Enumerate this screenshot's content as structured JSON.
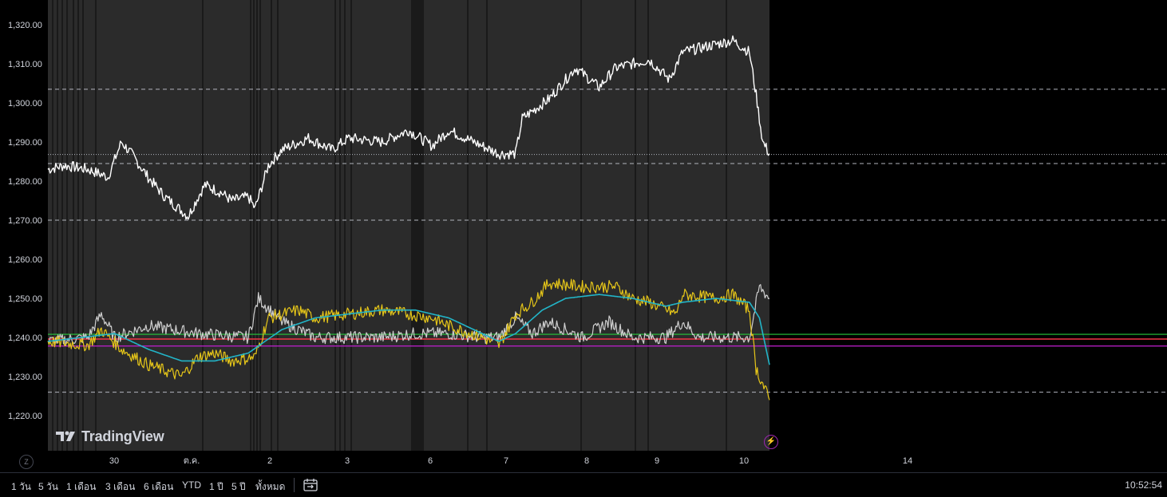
{
  "y_axis": {
    "ticks": [
      "1,320.00",
      "1,310.00",
      "1,300.00",
      "1,290.00",
      "1,280.00",
      "1,270.00",
      "1,260.00",
      "1,250.00",
      "1,240.00",
      "1,230.00",
      "1,220.00"
    ],
    "tick_values": [
      1320,
      1310,
      1300,
      1290,
      1280,
      1270,
      1260,
      1250,
      1240,
      1230,
      1220
    ]
  },
  "x_axis": {
    "ticks": [
      "30",
      "ต.ค.",
      "2",
      "3",
      "6",
      "7",
      "8",
      "9",
      "10",
      "14"
    ]
  },
  "scale_mode_label": "Z",
  "logo": {
    "text": "TradingView",
    "icon": "tradingview-logo-icon"
  },
  "alert_icon": "lightning-icon",
  "bottom_toolbar": {
    "ranges": [
      "1 วัน",
      "5 วัน",
      "1 เดือน",
      "3 เดือน",
      "6 เดือน",
      "YTD",
      "1 ปี",
      "5 ปี",
      "ทั้งหมด"
    ],
    "goto_icon": "calendar-goto-icon",
    "clock": "10:52:54"
  },
  "colors": {
    "price_line": "#ffffff",
    "white_osc": "#cfcfcf",
    "yellow_osc": "#e6c619",
    "cyan_ma": "#22b5c8",
    "green_level": "#26c93b",
    "red_level": "#f23645",
    "magenta_level": "#c21fd0",
    "dashed_level": "#b2b5be",
    "session_bg": "#2b2b2b"
  },
  "chart_data": {
    "type": "line",
    "title": "",
    "xlabel": "",
    "ylabel": "",
    "ylim": [
      1215,
      1324
    ],
    "horizontal_levels": {
      "dashed": [
        1303.5,
        1284.5,
        1270,
        1226
      ],
      "dotted": [
        1286.8
      ],
      "green": 1240.8,
      "red": 1239.6,
      "magenta": 1237.8
    },
    "series": [
      {
        "values": [
          [
            0,
            1283
          ],
          [
            5,
            1284
          ],
          [
            12,
            1283
          ],
          [
            18,
            1281
          ],
          [
            22,
            1290
          ],
          [
            25,
            1287
          ],
          [
            30,
            1281
          ],
          [
            35,
            1276
          ],
          [
            42,
            1271
          ],
          [
            45,
            1276
          ],
          [
            47,
            1279
          ],
          [
            52,
            1277
          ],
          [
            55,
            1275
          ],
          [
            60,
            1276
          ],
          [
            62,
            1273
          ],
          [
            66,
            1284
          ],
          [
            70,
            1288
          ],
          [
            78,
            1291
          ],
          [
            85,
            1288
          ],
          [
            90,
            1291
          ],
          [
            100,
            1290
          ],
          [
            108,
            1293
          ],
          [
            115,
            1289
          ],
          [
            120,
            1293
          ],
          [
            130,
            1289
          ],
          [
            135,
            1287
          ],
          [
            140,
            1287
          ],
          [
            142,
            1296
          ],
          [
            150,
            1301
          ],
          [
            158,
            1309
          ],
          [
            165,
            1304
          ],
          [
            170,
            1309
          ],
          [
            180,
            1311
          ],
          [
            186,
            1306
          ],
          [
            190,
            1313
          ],
          [
            200,
            1315
          ],
          [
            205,
            1316
          ],
          [
            210,
            1313
          ],
          [
            212,
            1302
          ],
          [
            214,
            1290
          ],
          [
            216,
            1287
          ]
        ]
      },
      {
        "values": [
          [
            0,
            1239
          ],
          [
            12,
            1240
          ],
          [
            16,
            1246
          ],
          [
            20,
            1240
          ],
          [
            30,
            1243
          ],
          [
            45,
            1241
          ],
          [
            60,
            1240
          ],
          [
            63,
            1250
          ],
          [
            70,
            1244
          ],
          [
            80,
            1240
          ],
          [
            100,
            1240
          ],
          [
            110,
            1241
          ],
          [
            120,
            1241
          ],
          [
            130,
            1240
          ],
          [
            135,
            1240
          ],
          [
            140,
            1245
          ],
          [
            145,
            1241
          ],
          [
            150,
            1244
          ],
          [
            160,
            1240
          ],
          [
            168,
            1244
          ],
          [
            175,
            1240
          ],
          [
            185,
            1240
          ],
          [
            190,
            1244
          ],
          [
            195,
            1240
          ],
          [
            210,
            1240
          ],
          [
            213,
            1253
          ],
          [
            216,
            1250
          ]
        ]
      },
      {
        "values": [
          [
            0,
            1239
          ],
          [
            12,
            1238
          ],
          [
            16,
            1242
          ],
          [
            22,
            1237
          ],
          [
            30,
            1233
          ],
          [
            40,
            1230
          ],
          [
            45,
            1235
          ],
          [
            50,
            1236
          ],
          [
            55,
            1234
          ],
          [
            62,
            1235
          ],
          [
            66,
            1245
          ],
          [
            75,
            1247
          ],
          [
            80,
            1245
          ],
          [
            90,
            1246
          ],
          [
            100,
            1247
          ],
          [
            108,
            1246
          ],
          [
            115,
            1245
          ],
          [
            120,
            1243
          ],
          [
            130,
            1240
          ],
          [
            135,
            1238
          ],
          [
            140,
            1246
          ],
          [
            145,
            1249
          ],
          [
            150,
            1254
          ],
          [
            160,
            1253
          ],
          [
            170,
            1253
          ],
          [
            175,
            1250
          ],
          [
            180,
            1249
          ],
          [
            188,
            1246
          ],
          [
            190,
            1251
          ],
          [
            200,
            1250
          ],
          [
            205,
            1251
          ],
          [
            210,
            1247
          ],
          [
            212,
            1232
          ],
          [
            216,
            1224
          ]
        ]
      },
      {
        "values": [
          [
            0,
            1239
          ],
          [
            20,
            1241
          ],
          [
            30,
            1237
          ],
          [
            40,
            1234
          ],
          [
            50,
            1234
          ],
          [
            60,
            1236
          ],
          [
            70,
            1242
          ],
          [
            80,
            1245
          ],
          [
            90,
            1246
          ],
          [
            100,
            1247
          ],
          [
            110,
            1247
          ],
          [
            120,
            1245
          ],
          [
            130,
            1241
          ],
          [
            135,
            1239
          ],
          [
            140,
            1241
          ],
          [
            148,
            1247
          ],
          [
            155,
            1250
          ],
          [
            165,
            1251
          ],
          [
            175,
            1250
          ],
          [
            185,
            1248
          ],
          [
            190,
            1249
          ],
          [
            200,
            1250
          ],
          [
            210,
            1249
          ],
          [
            213,
            1245
          ],
          [
            216,
            1233
          ]
        ]
      }
    ],
    "grid": false
  }
}
